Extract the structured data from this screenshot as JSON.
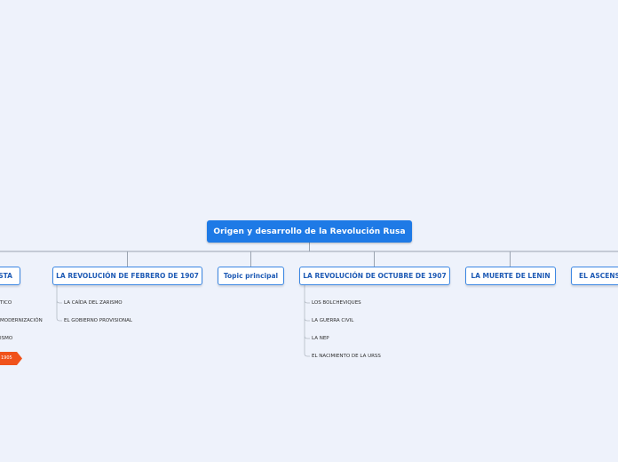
{
  "root": {
    "title": "Origen y desarrollo de la Revolución Rusa"
  },
  "branches": [
    {
      "label": "STA"
    },
    {
      "label": "LA REVOLUCIÓN DE FEBRERO DE 1907"
    },
    {
      "label": "Topic principal"
    },
    {
      "label": "LA REVOLUCIÓN DE OCTUBRE DE 1907"
    },
    {
      "label": "LA MUERTE DE LENIN"
    },
    {
      "label": "EL ASCENSO"
    }
  ],
  "leaves": {
    "branch0": [
      "TICO",
      "MODERNIZACIÓN",
      "ISMO",
      "1905"
    ],
    "branch1": [
      "LA CAÍDA DEL ZARISMO",
      "EL GOBIERNO PROVISIONAL"
    ],
    "branch3": [
      "LOS BOLCHEVIQUES",
      "LA GUERRA CIVIL",
      "LA NEP",
      "EL NACIMIENTO DE LA URSS"
    ]
  },
  "colors": {
    "background": "#eef2fb",
    "root_fill": "#1e7ae6",
    "branch_border": "#3a86e3",
    "branch_text": "#1f5bb5",
    "connector": "#9aa3b0",
    "flag": "#f0521b"
  }
}
